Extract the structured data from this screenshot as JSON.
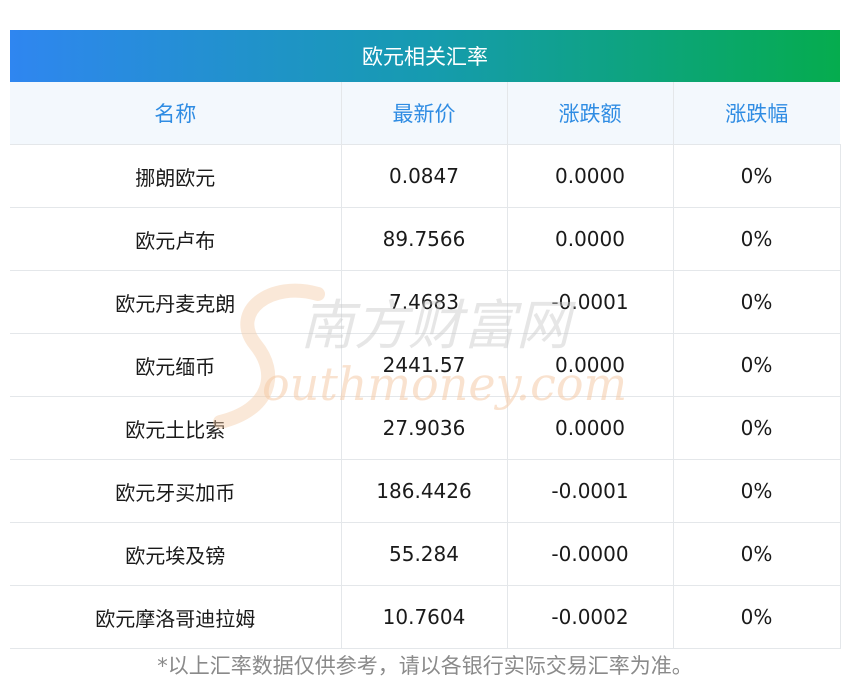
{
  "table": {
    "title": "欧元相关汇率",
    "columns": [
      "名称",
      "最新价",
      "涨跌额",
      "涨跌幅"
    ],
    "rows": [
      {
        "name": "挪朗欧元",
        "price": "0.0847",
        "change": "0.0000",
        "pct": "0%"
      },
      {
        "name": "欧元卢布",
        "price": "89.7566",
        "change": "0.0000",
        "pct": "0%"
      },
      {
        "name": "欧元丹麦克朗",
        "price": "7.4683",
        "change": "-0.0001",
        "pct": "0%"
      },
      {
        "name": "欧元缅币",
        "price": "2441.57",
        "change": "0.0000",
        "pct": "0%"
      },
      {
        "name": "欧元土比索",
        "price": "27.9036",
        "change": "0.0000",
        "pct": "0%"
      },
      {
        "name": "欧元牙买加币",
        "price": "186.4426",
        "change": "-0.0001",
        "pct": "0%"
      },
      {
        "name": "欧元埃及镑",
        "price": "55.284",
        "change": "-0.0000",
        "pct": "0%"
      },
      {
        "name": "欧元摩洛哥迪拉姆",
        "price": "10.7604",
        "change": "-0.0002",
        "pct": "0%"
      }
    ]
  },
  "watermark": {
    "cn": "南方财富网",
    "en": "outhmoney.com"
  },
  "footnote": "*以上汇率数据仅供参考，请以各银行实际交易汇率为准。",
  "colors": {
    "header_start": "#2f86f0",
    "header_end": "#05ac4e",
    "column_header_text": "#2f8ce3",
    "watermark": "#f5cba8"
  }
}
